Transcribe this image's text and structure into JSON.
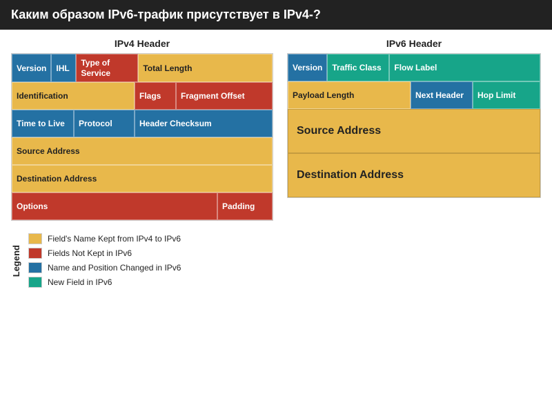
{
  "title": "Каким образом IPv6-трафик присутствует в IPv4-?",
  "ipv4": {
    "heading": "IPv4 Header",
    "cells": {
      "version": "Version",
      "ihl": "IHL",
      "type_of_service": "Type of Service",
      "total_length": "Total Length",
      "identification": "Identification",
      "flags": "Flags",
      "fragment_offset": "Fragment Offset",
      "time_to_live": "Time to Live",
      "protocol": "Protocol",
      "header_checksum": "Header Checksum",
      "source_address": "Source Address",
      "destination_address": "Destination Address",
      "options": "Options",
      "padding": "Padding"
    }
  },
  "ipv6": {
    "heading": "IPv6 Header",
    "cells": {
      "version": "Version",
      "traffic_class": "Traffic Class",
      "flow_label": "Flow Label",
      "payload_length": "Payload Length",
      "next_header": "Next Header",
      "hop_limit": "Hop Limit",
      "source_address": "Source Address",
      "destination_address": "Destination Address"
    }
  },
  "legend": {
    "label": "Legend",
    "items": [
      {
        "color": "#E8B84B",
        "text": "Field's Name Kept from IPv4 to IPv6"
      },
      {
        "color": "#C0392B",
        "text": "Fields Not Kept in IPv6"
      },
      {
        "color": "#2471A3",
        "text": "Name and Position Changed in IPv6"
      },
      {
        "color": "#17A589",
        "text": "New Field in IPv6"
      }
    ]
  }
}
